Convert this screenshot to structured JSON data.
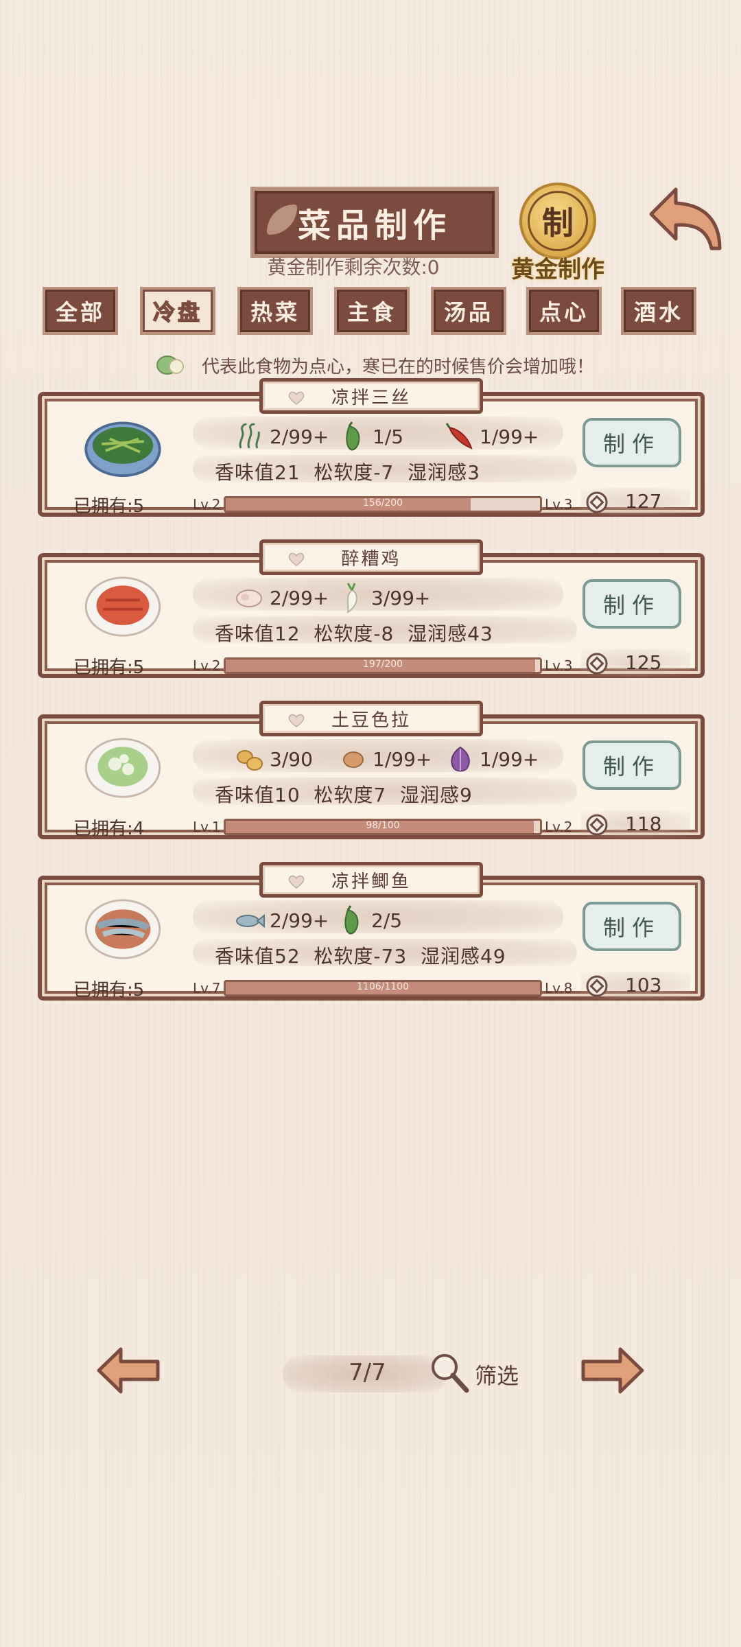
{
  "header": {
    "title": "菜品制作",
    "remaining_label": "黄金制作剩余次数:0",
    "gold_badge_glyph": "制",
    "gold_label": "黄金制作"
  },
  "tabs": [
    {
      "label": "全部",
      "active": false
    },
    {
      "label": "冷盘",
      "active": true
    },
    {
      "label": "热菜",
      "active": false
    },
    {
      "label": "主食",
      "active": false
    },
    {
      "label": "汤品",
      "active": false
    },
    {
      "label": "点心",
      "active": false
    },
    {
      "label": "酒水",
      "active": false
    }
  ],
  "hint": "代表此食物为点心，寒已在的时候售价会增加哦！",
  "recipes": [
    {
      "name": "凉拌三丝",
      "owned": "已拥有:5",
      "ingredients": [
        {
          "icon": "seaweed-icon",
          "qty": "2/99+"
        },
        {
          "icon": "green-pepper-icon",
          "qty": "1/5"
        },
        {
          "icon": "red-chili-icon",
          "qty": "1/99+"
        }
      ],
      "stats": "香味值21  松软度-7  湿润感3",
      "lv_from": "Lv.2",
      "lv_to": "Lv.3",
      "progress_text": "156/200",
      "progress": 0.78,
      "make_label": "制作",
      "price": "127"
    },
    {
      "name": "醉糟鸡",
      "owned": "已拥有:5",
      "ingredients": [
        {
          "icon": "chicken-icon",
          "qty": "2/99+"
        },
        {
          "icon": "radish-icon",
          "qty": "3/99+"
        }
      ],
      "stats": "香味值12  松软度-8  湿润感43",
      "lv_from": "Lv.2",
      "lv_to": "Lv.3",
      "progress_text": "197/200",
      "progress": 0.985,
      "make_label": "制作",
      "price": "125"
    },
    {
      "name": "土豆色拉",
      "owned": "已拥有:4",
      "ingredients": [
        {
          "icon": "potato-icon",
          "qty": "3/90"
        },
        {
          "icon": "egg-icon",
          "qty": "1/99+"
        },
        {
          "icon": "onion-icon",
          "qty": "1/99+"
        }
      ],
      "stats": "香味值10  松软度7  湿润感9",
      "lv_from": "Lv.1",
      "lv_to": "Lv.2",
      "progress_text": "98/100",
      "progress": 0.98,
      "make_label": "制作",
      "price": "118"
    },
    {
      "name": "凉拌鲫鱼",
      "owned": "已拥有:5",
      "ingredients": [
        {
          "icon": "fish-icon",
          "qty": "2/99+"
        },
        {
          "icon": "green-pepper-icon",
          "qty": "2/5"
        }
      ],
      "stats": "香味值52  松软度-73  湿润感49",
      "lv_from": "Lv.7",
      "lv_to": "Lv.8",
      "progress_text": "1106/1100",
      "progress": 1.0,
      "make_label": "制作",
      "price": "103"
    }
  ],
  "pager": {
    "page": "7/7",
    "filter_label": "筛选"
  },
  "colors": {
    "frame": "#7a4b3e",
    "background": "#f5eadf",
    "button_green": "#e5eeea",
    "gold": "#e3b65a"
  }
}
